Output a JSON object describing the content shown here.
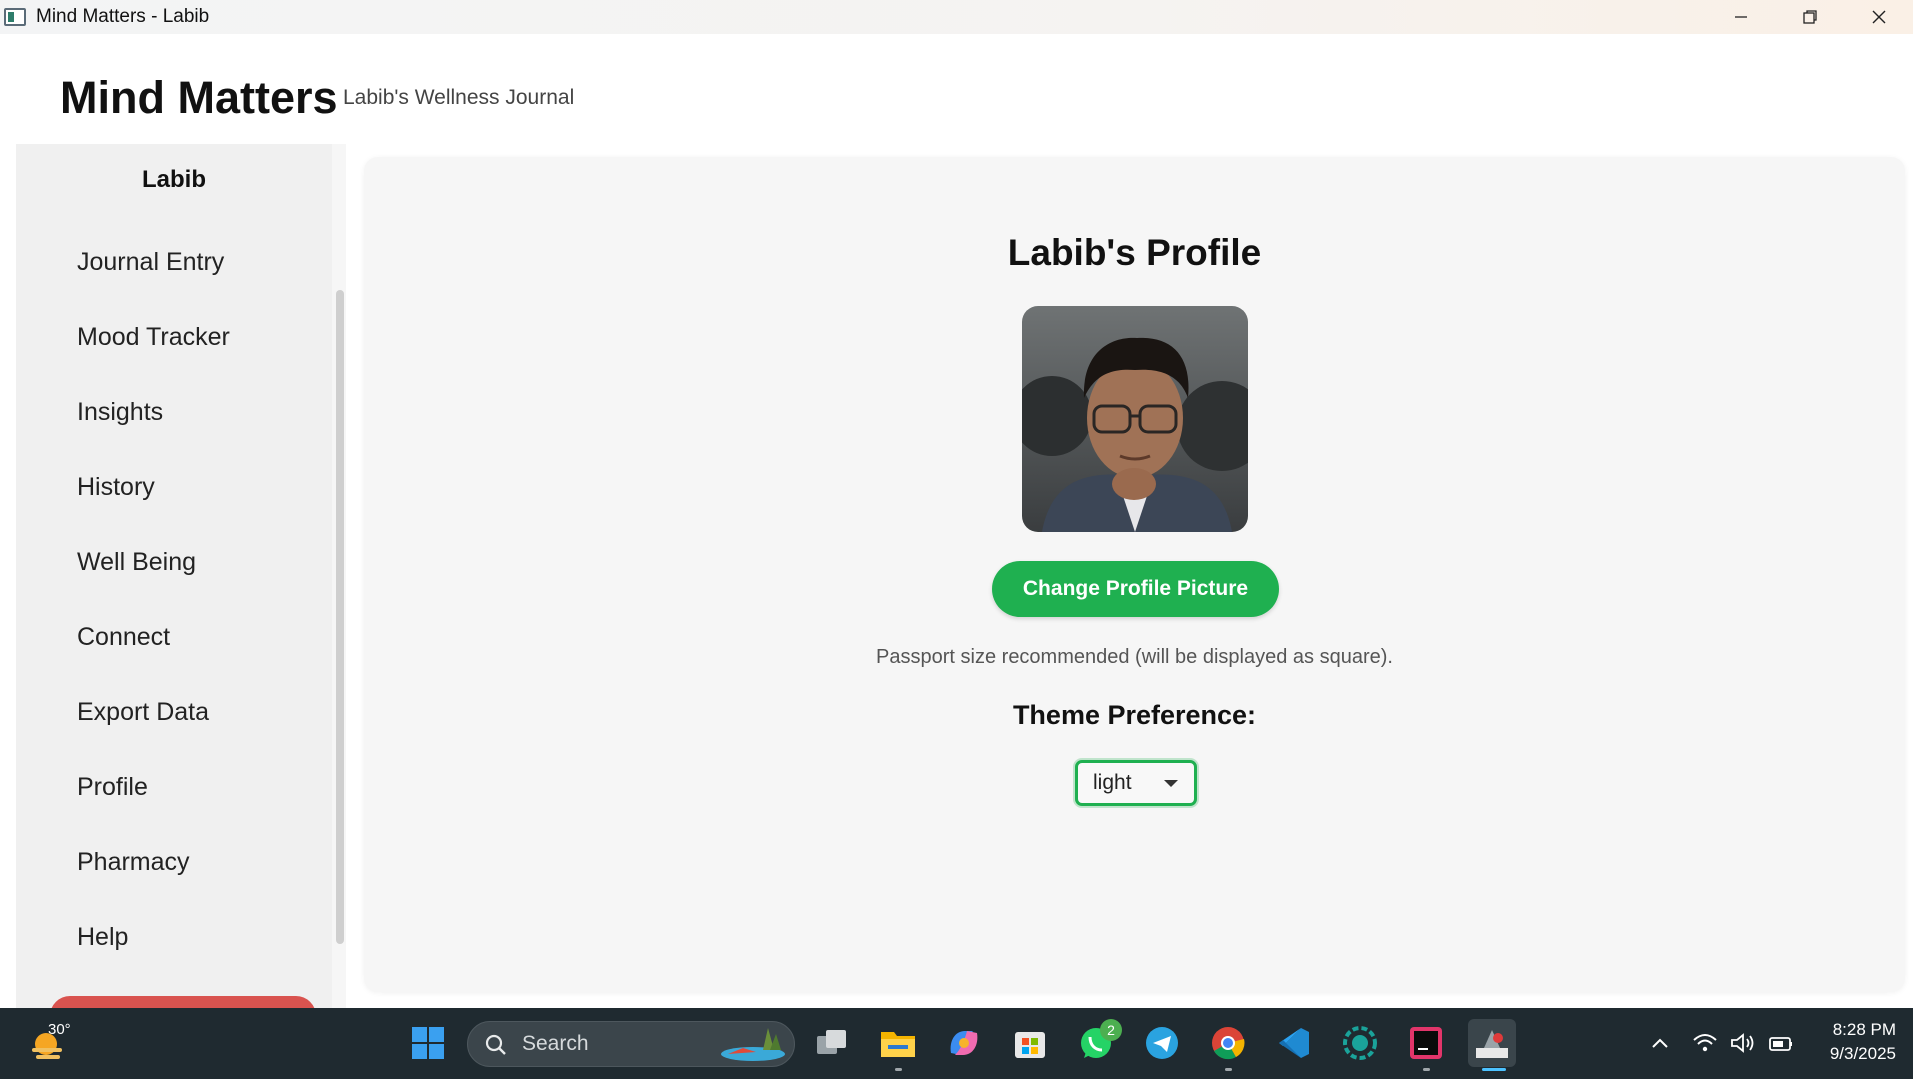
{
  "window": {
    "title": "Mind Matters - Labib"
  },
  "header": {
    "brand": "Mind Matters",
    "tagline": "Labib's Wellness Journal"
  },
  "sidebar": {
    "user": "Labib",
    "items": [
      {
        "label": "Journal Entry"
      },
      {
        "label": "Mood Tracker"
      },
      {
        "label": "Insights"
      },
      {
        "label": "History"
      },
      {
        "label": "Well Being"
      },
      {
        "label": "Connect"
      },
      {
        "label": "Export Data"
      },
      {
        "label": "Profile"
      },
      {
        "label": "Pharmacy"
      },
      {
        "label": "Help"
      }
    ]
  },
  "profile": {
    "title": "Labib's Profile",
    "change_picture_label": "Change Profile Picture",
    "hint": "Passport size recommended (will be displayed as square).",
    "theme_label": "Theme Preference:",
    "theme_value": "light"
  },
  "taskbar": {
    "weather_temp": "30°",
    "search_label": "Search",
    "whatsapp_badge": "2",
    "time": "8:28 PM",
    "date": "9/3/2025",
    "icons": [
      "windows-start-icon",
      "search-icon",
      "task-view-icon",
      "file-explorer-icon",
      "copilot-icon",
      "microsoft-store-icon",
      "whatsapp-icon",
      "telegram-icon",
      "chrome-icon",
      "vscode-icon",
      "app-icon",
      "intellij-icon",
      "java-app-icon",
      "chevron-up-icon",
      "wifi-icon",
      "volume-icon",
      "battery-icon"
    ]
  },
  "colors": {
    "accent": "#1fb050",
    "logout": "#d9534f",
    "taskbar": "#1f2a30"
  }
}
